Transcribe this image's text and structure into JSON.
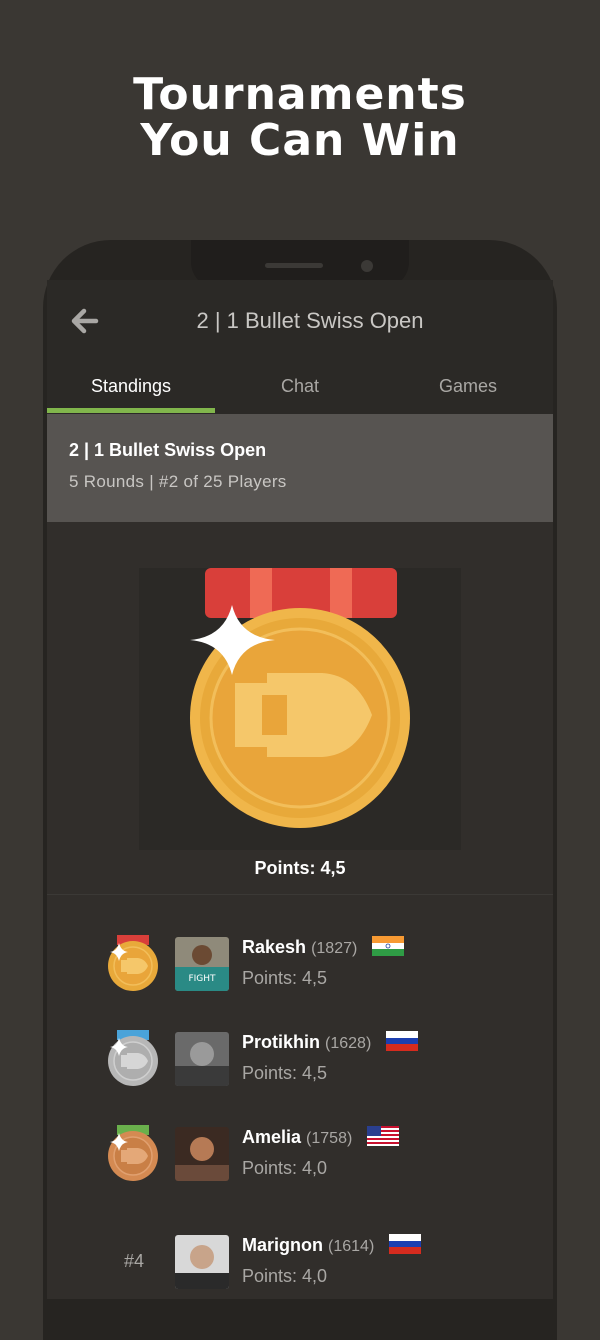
{
  "promo": {
    "title_line1": "Tournaments",
    "title_line2": "You Can Win"
  },
  "header": {
    "back_icon": "arrow-left-icon",
    "title": "2 | 1 Bullet Swiss Open"
  },
  "tabs": [
    {
      "label": "Standings",
      "active": true
    },
    {
      "label": "Chat",
      "active": false
    },
    {
      "label": "Games",
      "active": false
    }
  ],
  "tournament": {
    "name": "2 | 1 Bullet Swiss Open",
    "summary": "5 Rounds | #2 of 25 Players"
  },
  "my_result": {
    "medal": "gold",
    "points_text": "Points: 4,5"
  },
  "standings": [
    {
      "rank_medal": "gold",
      "name": "Rakesh",
      "rating": "(1827)",
      "flag": "india",
      "points": "Points: 4,5"
    },
    {
      "rank_medal": "silver",
      "name": "Protikhin",
      "rating": "(1628)",
      "flag": "russia",
      "points": "Points: 4,5"
    },
    {
      "rank_medal": "bronze",
      "name": "Amelia",
      "rating": "(1758)",
      "flag": "usa",
      "points": "Points: 4,0"
    },
    {
      "rank": "#4",
      "name": "Marignon",
      "rating": "(1614)",
      "flag": "russia",
      "points": "Points: 4,0"
    }
  ],
  "colors": {
    "background": "#3a3733",
    "accent": "#81b64c",
    "gold": "#e8a93a",
    "ribbon_red": "#d94a3d"
  }
}
